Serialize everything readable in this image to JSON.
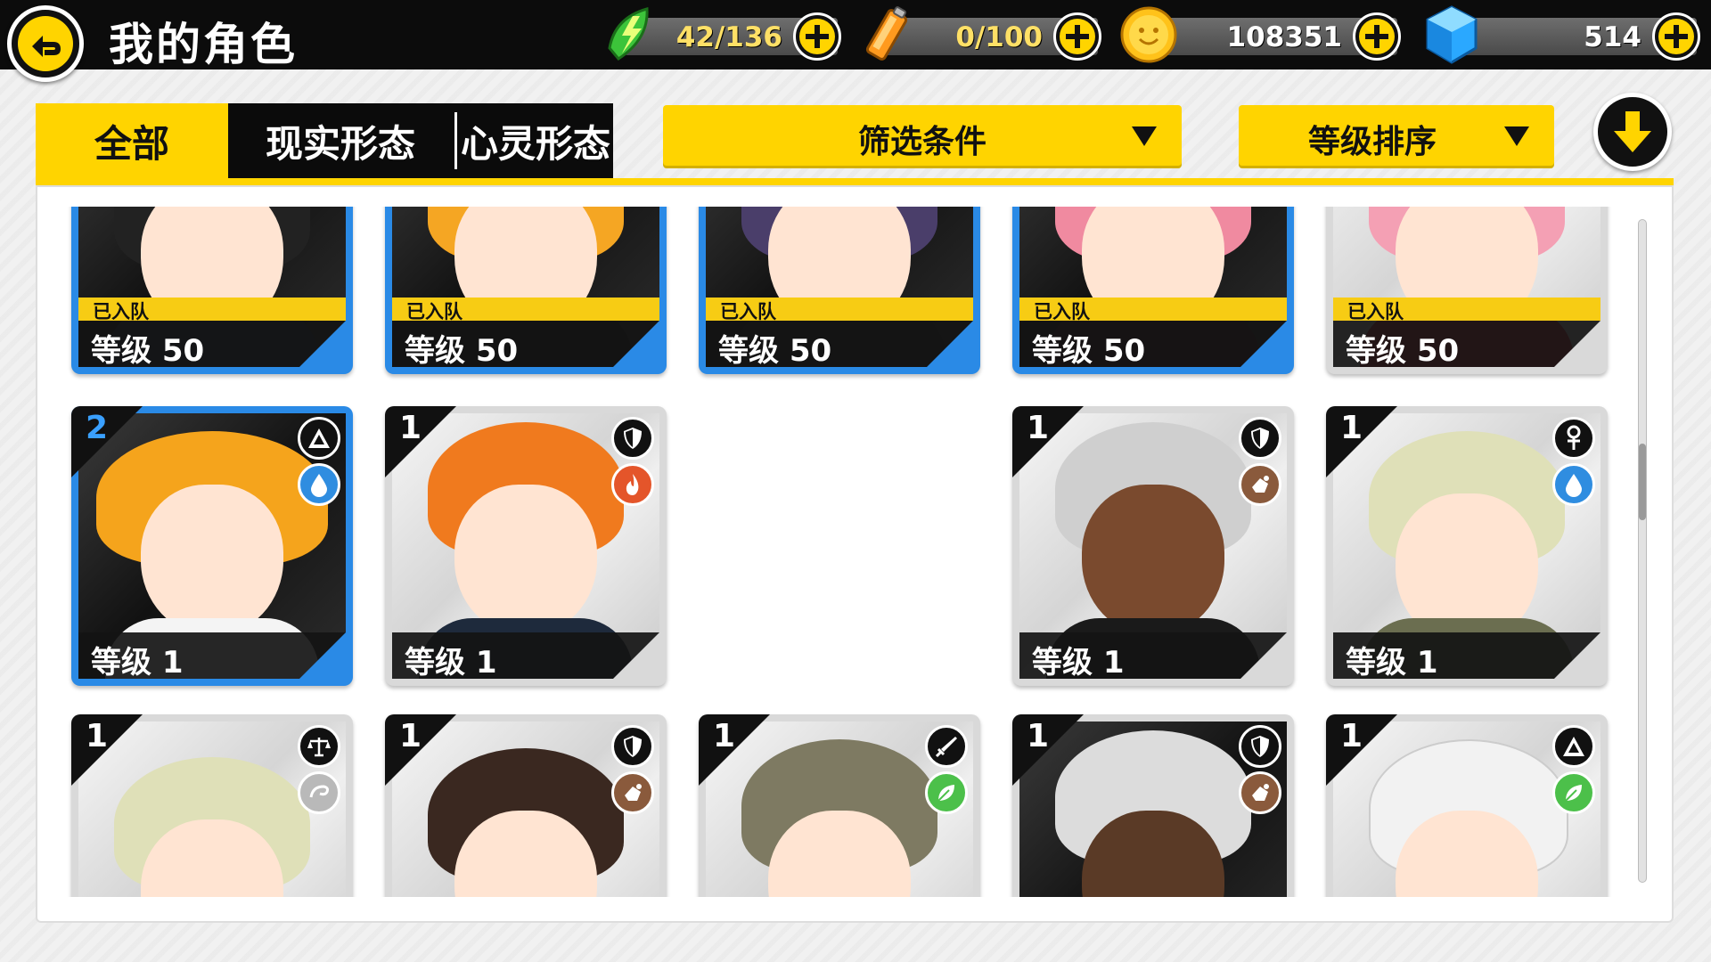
{
  "header": {
    "title": "我的角色",
    "back_icon": "back-arrow-icon"
  },
  "resources": [
    {
      "id": "stamina",
      "icon": "lightning-icon",
      "value": "42/136"
    },
    {
      "id": "battery",
      "icon": "battery-icon",
      "value": "0/100"
    },
    {
      "id": "coins",
      "icon": "coin-icon",
      "value": "108351"
    },
    {
      "id": "gems",
      "icon": "gem-icon",
      "value": "514"
    }
  ],
  "tabs": [
    {
      "label": "全部",
      "active": true
    },
    {
      "label": "现实形态",
      "active": false
    },
    {
      "label": "心灵形态",
      "active": false
    }
  ],
  "filters": {
    "condition_label": "筛选条件",
    "sort_label": "等级排序"
  },
  "row1": [
    {
      "tag": "已入队",
      "level": "等级 50",
      "frame": "blue"
    },
    {
      "tag": "已入队",
      "level": "等级 50",
      "frame": "blue"
    },
    {
      "tag": "已入队",
      "level": "等级 50",
      "frame": "blue"
    },
    {
      "tag": "已入队",
      "level": "等级 50",
      "frame": "blue"
    },
    {
      "tag": "已入队",
      "level": "等级 50",
      "frame": "gray"
    }
  ],
  "row2": [
    {
      "rank": "2",
      "level": "等级 1",
      "role": "triangle-icon",
      "element": "water-icon",
      "frame": "blue"
    },
    {
      "rank": "1",
      "level": "等级 1",
      "role": "shield-icon",
      "element": "fire-icon",
      "frame": "gray"
    },
    {
      "rank": "1",
      "level": "等级 1",
      "role": "shield-icon",
      "element": "earth-icon",
      "frame": "gray"
    },
    {
      "rank": "1",
      "level": "等级 1",
      "role": "ankh-icon",
      "element": "water-icon",
      "frame": "gray"
    }
  ],
  "row3": [
    {
      "rank": "1",
      "role": "scales-icon",
      "element": "wind-icon"
    },
    {
      "rank": "1",
      "role": "shield-icon",
      "element": "earth-icon"
    },
    {
      "rank": "1",
      "role": "sword-icon",
      "element": "leaf-icon"
    },
    {
      "rank": "1",
      "role": "shield-icon",
      "element": "earth-icon"
    },
    {
      "rank": "1",
      "role": "triangle-icon",
      "element": "leaf-icon"
    }
  ],
  "colors": {
    "accent": "#ffd400",
    "team_tag": "#f7cc14",
    "frame_blue": "#2a8ae6",
    "fire": "#e4552a",
    "water": "#2f8de0",
    "earth": "#8a5a3c",
    "leaf": "#4cc04a",
    "wind": "#b9b9b9"
  }
}
